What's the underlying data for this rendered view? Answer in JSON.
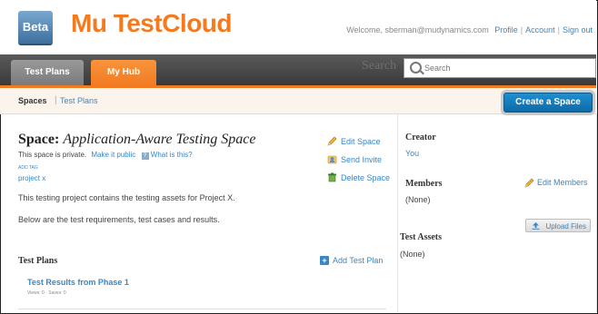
{
  "header": {
    "beta_label": "Beta",
    "logo_text": "Mu TestCloud",
    "welcome_text": "Welcome, sberman@mudynamics.com",
    "links": [
      "Profile",
      "Account",
      "Sign out"
    ]
  },
  "nav": {
    "tabs": [
      {
        "label": "Test Plans",
        "active": false
      },
      {
        "label": "My Hub",
        "active": true
      }
    ],
    "search_label": "Search",
    "search_placeholder": "Search"
  },
  "breadcrumb": {
    "current": "Spaces",
    "link": "Test Plans"
  },
  "create_button": "Create a Space",
  "space": {
    "title_prefix": "Space:",
    "title_name": "Application-Aware Testing Space",
    "private_text": "This space is private.",
    "make_public": "Make it public",
    "what_is_this": "What is this?",
    "add_tag": "ADD TAG",
    "tag": "project x",
    "description_1": "This testing project contains the testing assets for Project X.",
    "description_2": "Below are the test requirements, test cases and results.",
    "actions": [
      {
        "label": "Edit Space",
        "icon": "pencil-icon"
      },
      {
        "label": "Send Invite",
        "icon": "invite-icon"
      },
      {
        "label": "Delete Space",
        "icon": "trash-icon"
      }
    ]
  },
  "test_plans": {
    "heading": "Test Plans",
    "add_label": "Add Test Plan",
    "items": [
      {
        "name": "Test Results from Phase 1",
        "meta": "Views: 0 · Saves: 0"
      }
    ]
  },
  "sidebar": {
    "creator_heading": "Creator",
    "creator_value": "You",
    "members_heading": "Members",
    "members_value": "(None)",
    "edit_members": "Edit Members",
    "upload_label": "Upload Files",
    "assets_heading": "Test Assets",
    "assets_value": "(None)"
  },
  "colors": {
    "brand_orange": "#f27b22",
    "link_blue": "#3a86c6",
    "button_blue": "#0e6aa8"
  }
}
